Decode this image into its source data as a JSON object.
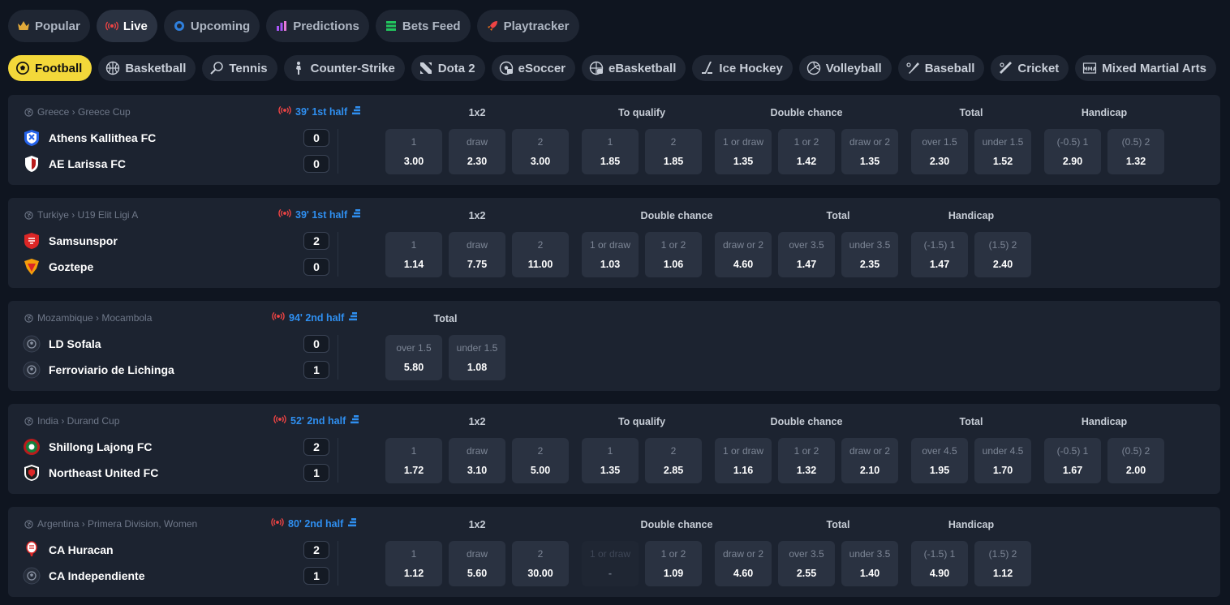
{
  "top_nav": [
    {
      "label": "Popular",
      "icon": "crown-icon",
      "active": false
    },
    {
      "label": "Live",
      "icon": "live-icon",
      "active": true
    },
    {
      "label": "Upcoming",
      "icon": "clock-icon",
      "active": false
    },
    {
      "label": "Predictions",
      "icon": "predictions-icon",
      "active": false
    },
    {
      "label": "Bets Feed",
      "icon": "feed-icon",
      "active": false
    },
    {
      "label": "Playtracker",
      "icon": "rocket-icon",
      "active": false
    }
  ],
  "sports": [
    {
      "label": "Football",
      "icon": "football-icon",
      "active": true
    },
    {
      "label": "Basketball",
      "icon": "basketball-icon"
    },
    {
      "label": "Tennis",
      "icon": "tennis-icon"
    },
    {
      "label": "Counter-Strike",
      "icon": "counter-strike-icon"
    },
    {
      "label": "Dota 2",
      "icon": "dota-icon"
    },
    {
      "label": "eSoccer",
      "icon": "esoccer-icon"
    },
    {
      "label": "eBasketball",
      "icon": "ebasketball-icon"
    },
    {
      "label": "Ice Hockey",
      "icon": "ice-hockey-icon"
    },
    {
      "label": "Volleyball",
      "icon": "volleyball-icon"
    },
    {
      "label": "Baseball",
      "icon": "baseball-icon"
    },
    {
      "label": "Cricket",
      "icon": "cricket-icon"
    },
    {
      "label": "Mixed Martial Arts",
      "icon": "mma-icon"
    }
  ],
  "events": [
    {
      "league": "Greece › Greece Cup",
      "status": "39' 1st half",
      "team1": "Athens Kallithea FC",
      "score1": "0",
      "logo1": "shield-blue",
      "team2": "AE Larissa FC",
      "score2": "0",
      "logo2": "shield-redwhite",
      "markets": [
        {
          "title": "1x2",
          "odds": [
            {
              "label": "1",
              "value": "3.00"
            },
            {
              "label": "draw",
              "value": "2.30"
            },
            {
              "label": "2",
              "value": "3.00"
            }
          ]
        },
        {
          "title": "To qualify",
          "odds": [
            {
              "label": "1",
              "value": "1.85"
            },
            {
              "label": "2",
              "value": "1.85"
            }
          ]
        },
        {
          "title": "Double chance",
          "odds": [
            {
              "label": "1 or draw",
              "value": "1.35"
            },
            {
              "label": "1 or 2",
              "value": "1.42"
            },
            {
              "label": "draw or 2",
              "value": "1.35"
            }
          ]
        },
        {
          "title": "Total",
          "odds": [
            {
              "label": "over 1.5",
              "value": "2.30"
            },
            {
              "label": "under 1.5",
              "value": "1.52"
            }
          ]
        },
        {
          "title": "Handicap",
          "odds": [
            {
              "label": "(-0.5) 1",
              "value": "2.90"
            },
            {
              "label": "(0.5) 2",
              "value": "1.32"
            }
          ]
        }
      ]
    },
    {
      "league": "Turkiye › U19 Elit Ligi A",
      "status": "39' 1st half",
      "team1": "Samsunspor",
      "score1": "2",
      "logo1": "shield-red",
      "team2": "Goztepe",
      "score2": "0",
      "logo2": "shield-orange",
      "markets": [
        {
          "title": "1x2",
          "odds": [
            {
              "label": "1",
              "value": "1.14"
            },
            {
              "label": "draw",
              "value": "7.75"
            },
            {
              "label": "2",
              "value": "11.00"
            }
          ]
        },
        {
          "title": "Double chance",
          "odds": [
            {
              "label": "1 or draw",
              "value": "1.03"
            },
            {
              "label": "1 or 2",
              "value": "1.06"
            },
            {
              "label": "draw or 2",
              "value": "4.60"
            }
          ]
        },
        {
          "title": "Total",
          "odds": [
            {
              "label": "over 3.5",
              "value": "1.47"
            },
            {
              "label": "under 3.5",
              "value": "2.35"
            }
          ]
        },
        {
          "title": "Handicap",
          "odds": [
            {
              "label": "(-1.5) 1",
              "value": "1.47"
            },
            {
              "label": "(1.5) 2",
              "value": "2.40"
            }
          ]
        }
      ]
    },
    {
      "league": "Mozambique › Mocambola",
      "status": "94' 2nd half",
      "team1": "LD Sofala",
      "score1": "0",
      "logo1": "ball-generic",
      "team2": "Ferroviario de Lichinga",
      "score2": "1",
      "logo2": "ball-generic",
      "markets": [
        {
          "title": "Total",
          "odds": [
            {
              "label": "over 1.5",
              "value": "5.80"
            },
            {
              "label": "under 1.5",
              "value": "1.08"
            }
          ]
        }
      ]
    },
    {
      "league": "India › Durand Cup",
      "status": "52' 2nd half",
      "team1": "Shillong Lajong FC",
      "score1": "2",
      "logo1": "circle-redgreen",
      "team2": "Northeast United FC",
      "score2": "1",
      "logo2": "shield-dark",
      "markets": [
        {
          "title": "1x2",
          "odds": [
            {
              "label": "1",
              "value": "1.72"
            },
            {
              "label": "draw",
              "value": "3.10"
            },
            {
              "label": "2",
              "value": "5.00"
            }
          ]
        },
        {
          "title": "To qualify",
          "odds": [
            {
              "label": "1",
              "value": "1.35"
            },
            {
              "label": "2",
              "value": "2.85"
            }
          ]
        },
        {
          "title": "Double chance",
          "odds": [
            {
              "label": "1 or draw",
              "value": "1.16"
            },
            {
              "label": "1 or 2",
              "value": "1.32"
            },
            {
              "label": "draw or 2",
              "value": "2.10"
            }
          ]
        },
        {
          "title": "Total",
          "odds": [
            {
              "label": "over 4.5",
              "value": "1.95"
            },
            {
              "label": "under 4.5",
              "value": "1.70"
            }
          ]
        },
        {
          "title": "Handicap",
          "odds": [
            {
              "label": "(-0.5) 1",
              "value": "1.67"
            },
            {
              "label": "(0.5) 2",
              "value": "2.00"
            }
          ]
        }
      ]
    },
    {
      "league": "Argentina › Primera Division, Women",
      "status": "80' 2nd half",
      "team1": "CA Huracan",
      "score1": "2",
      "logo1": "balloon-red",
      "team2": "CA Independiente",
      "score2": "1",
      "logo2": "ball-generic",
      "markets": [
        {
          "title": "1x2",
          "odds": [
            {
              "label": "1",
              "value": "1.12"
            },
            {
              "label": "draw",
              "value": "5.60"
            },
            {
              "label": "2",
              "value": "30.00"
            }
          ]
        },
        {
          "title": "Double chance",
          "odds": [
            {
              "label": "1 or draw",
              "value": "-",
              "disabled": true
            },
            {
              "label": "1 or 2",
              "value": "1.09"
            },
            {
              "label": "draw or 2",
              "value": "4.60"
            }
          ]
        },
        {
          "title": "Total",
          "odds": [
            {
              "label": "over 3.5",
              "value": "2.55"
            },
            {
              "label": "under 3.5",
              "value": "1.40"
            }
          ]
        },
        {
          "title": "Handicap",
          "odds": [
            {
              "label": "(-1.5) 1",
              "value": "4.90"
            },
            {
              "label": "(1.5) 2",
              "value": "1.12"
            }
          ]
        }
      ]
    }
  ],
  "colors": {
    "background": "#0f1520",
    "card": "#1c2330",
    "odd_button": "#2a3241",
    "accent_yellow": "#f3d83a",
    "live_red": "#ef4444",
    "status_blue": "#2f8ff0"
  }
}
